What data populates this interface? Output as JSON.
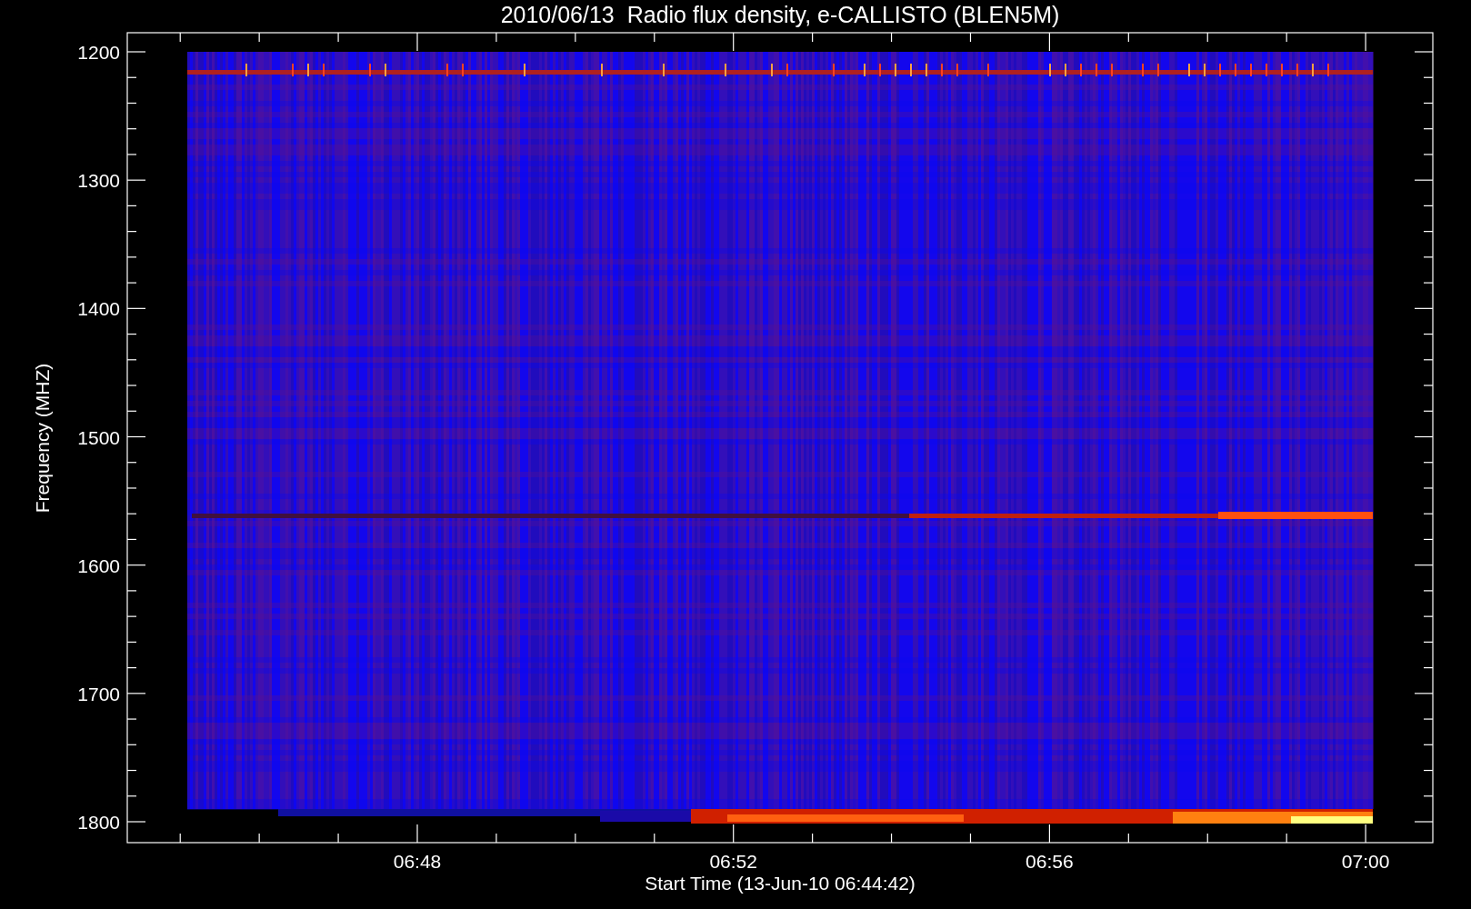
{
  "title": "2010/06/13  Radio flux density, e-CALLISTO (BLEN5M)",
  "y_axis": {
    "label": "Frequency (MHZ)",
    "ticks": [
      "1200",
      "1300",
      "1400",
      "1500",
      "1600",
      "1700",
      "1800"
    ]
  },
  "x_axis": {
    "label": "Start Time (13-Jun-10 06:44:42)",
    "ticks": [
      "06:48",
      "06:52",
      "06:56",
      "07:00"
    ]
  }
}
